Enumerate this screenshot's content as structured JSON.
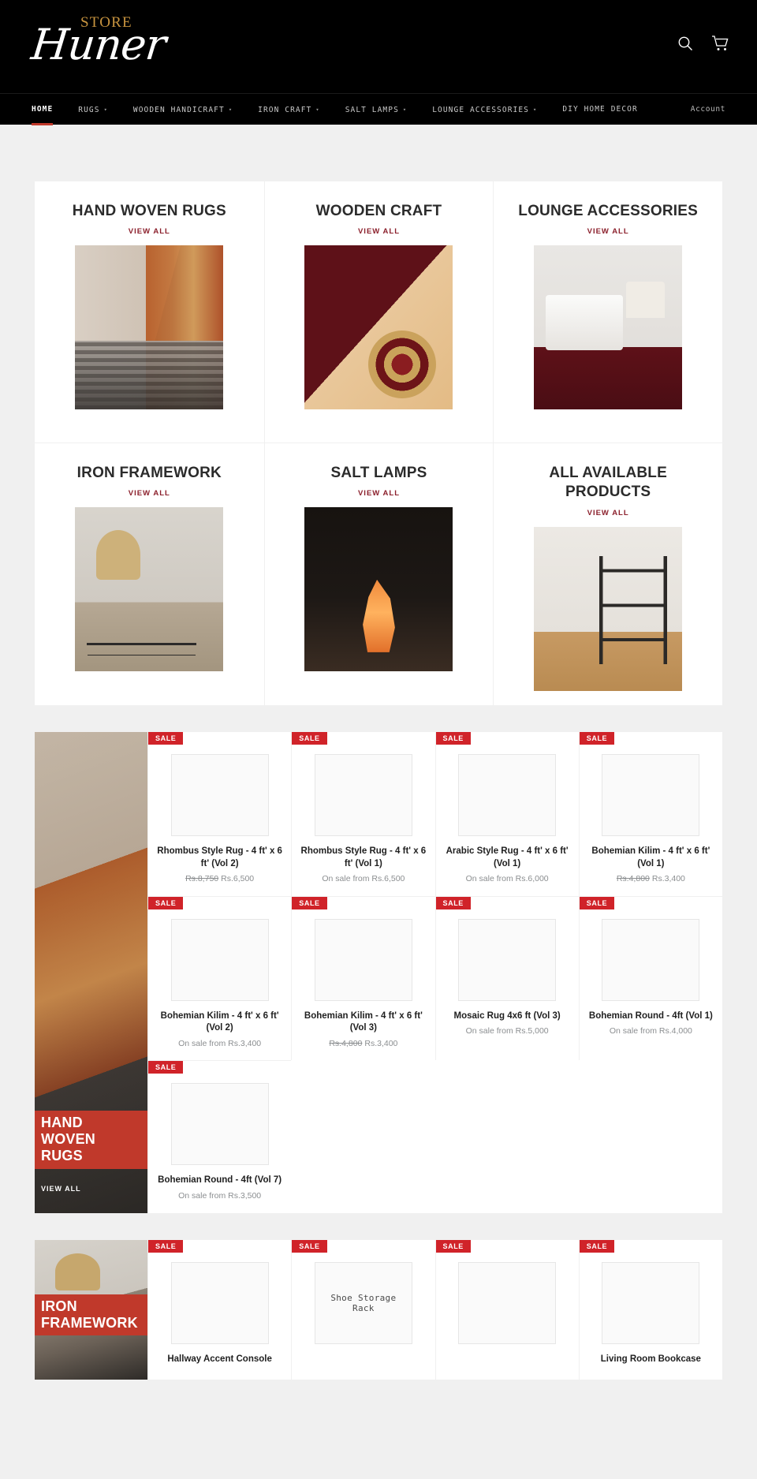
{
  "header": {
    "logo_top": "STORE",
    "logo_main": "Huner",
    "search_icon": "search-icon",
    "cart_icon": "cart-icon"
  },
  "nav": {
    "items": [
      {
        "label": "HOME",
        "has_caret": false,
        "active": true
      },
      {
        "label": "RUGS",
        "has_caret": true,
        "active": false
      },
      {
        "label": "WOODEN HANDICRAFT",
        "has_caret": true,
        "active": false
      },
      {
        "label": "IRON CRAFT",
        "has_caret": true,
        "active": false
      },
      {
        "label": "SALT LAMPS",
        "has_caret": true,
        "active": false
      },
      {
        "label": "LOUNGE ACCESSORIES",
        "has_caret": true,
        "active": false
      },
      {
        "label": "DIY HOME DECOR",
        "has_caret": false,
        "active": false
      }
    ],
    "account_label": "Account",
    "accent_color": "#c0392b"
  },
  "categories": [
    {
      "title": "HAND WOVEN RUGS",
      "view_all": "VIEW ALL",
      "art": "art-rugs"
    },
    {
      "title": "WOODEN CRAFT",
      "view_all": "VIEW ALL",
      "art": "art-wood"
    },
    {
      "title": "LOUNGE ACCESSORIES",
      "view_all": "VIEW ALL",
      "art": "art-lounge"
    },
    {
      "title": "IRON FRAMEWORK",
      "view_all": "VIEW ALL",
      "art": "art-iron"
    },
    {
      "title": "SALT LAMPS",
      "view_all": "VIEW ALL",
      "art": "art-salt"
    },
    {
      "title": "ALL AVAILABLE PRODUCTS",
      "view_all": "VIEW ALL",
      "art": "art-all"
    }
  ],
  "collections": [
    {
      "promo_label": "HAND WOVEN RUGS",
      "promo_view_all": "VIEW ALL",
      "promo_art": "promo-rugs",
      "products": [
        {
          "badge": "SALE",
          "title": "Rhombus Style Rug - 4 ft' x 6 ft' (Vol 2)",
          "price_old": "Rs.8,750",
          "price_now": "Rs.6,500",
          "img_text": ""
        },
        {
          "badge": "SALE",
          "title": "Rhombus Style Rug - 4 ft' x 6 ft' (Vol 1)",
          "price_old": "",
          "price_now": "On sale from Rs.6,500",
          "img_text": ""
        },
        {
          "badge": "SALE",
          "title": "Arabic Style Rug - 4 ft' x 6 ft' (Vol 1)",
          "price_old": "",
          "price_now": "On sale from Rs.6,000",
          "img_text": ""
        },
        {
          "badge": "SALE",
          "title": "Bohemian Kilim - 4 ft' x 6 ft' (Vol 1)",
          "price_old": "Rs.4,800",
          "price_now": "Rs.3,400",
          "img_text": ""
        },
        {
          "badge": "SALE",
          "title": "Bohemian Kilim - 4 ft' x 6 ft' (Vol 2)",
          "price_old": "",
          "price_now": "On sale from Rs.3,400",
          "img_text": ""
        },
        {
          "badge": "SALE",
          "title": "Bohemian Kilim - 4 ft' x 6 ft' (Vol 3)",
          "price_old": "Rs.4,800",
          "price_now": "Rs.3,400",
          "img_text": ""
        },
        {
          "badge": "SALE",
          "title": "Mosaic Rug 4x6 ft (Vol 3)",
          "price_old": "",
          "price_now": "On sale from Rs.5,000",
          "img_text": ""
        },
        {
          "badge": "SALE",
          "title": "Bohemian Round - 4ft (Vol 1)",
          "price_old": "",
          "price_now": "On sale from Rs.4,000",
          "img_text": ""
        },
        {
          "badge": "SALE",
          "title": "Bohemian Round - 4ft (Vol 7)",
          "price_old": "",
          "price_now": "On sale from Rs.3,500",
          "img_text": ""
        }
      ]
    },
    {
      "promo_label": "IRON FRAMEWORK",
      "promo_view_all": "",
      "promo_art": "promo-iron",
      "products": [
        {
          "badge": "SALE",
          "title": "Hallway Accent Console",
          "price_old": "",
          "price_now": "",
          "img_text": ""
        },
        {
          "badge": "SALE",
          "title": "",
          "price_old": "",
          "price_now": "",
          "img_text": "Shoe Storage Rack"
        },
        {
          "badge": "SALE",
          "title": "",
          "price_old": "",
          "price_now": "",
          "img_text": ""
        },
        {
          "badge": "SALE",
          "title": "Living Room Bookcase",
          "price_old": "",
          "price_now": "",
          "img_text": ""
        }
      ]
    }
  ]
}
